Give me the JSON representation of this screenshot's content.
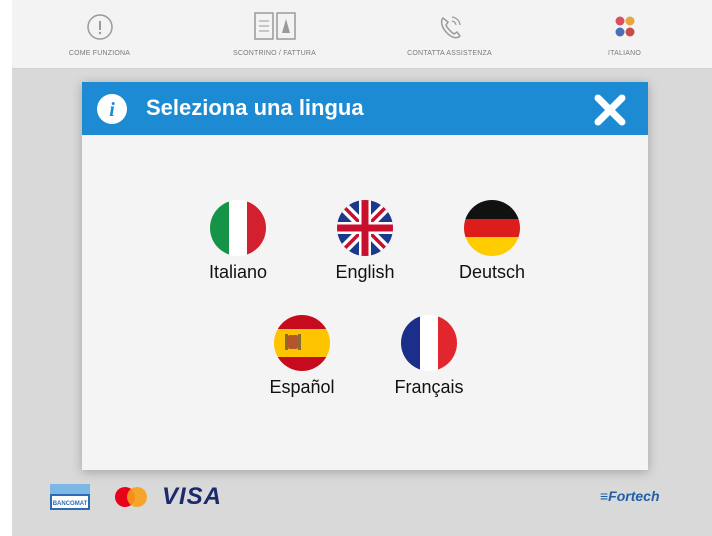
{
  "topbar": {
    "items": [
      {
        "label": "COME FUNZIONA",
        "icon": "info-circle-icon"
      },
      {
        "label": "SCONTRINO / FATTURA",
        "icon": "receipt-icon"
      },
      {
        "label": "CONTATTA ASSISTENZA",
        "icon": "phone-icon"
      },
      {
        "label": "ITALIANO",
        "icon": "flags-icon"
      }
    ]
  },
  "modal": {
    "title": "Seleziona una lingua",
    "languages": [
      {
        "label": "Italiano",
        "flag": "italy-flag-icon"
      },
      {
        "label": "English",
        "flag": "uk-flag-icon"
      },
      {
        "label": "Deutsch",
        "flag": "germany-flag-icon"
      },
      {
        "label": "Español",
        "flag": "spain-flag-icon"
      },
      {
        "label": "Français",
        "flag": "france-flag-icon"
      }
    ]
  },
  "footer": {
    "payment_logos": [
      "pagobancomat-logo",
      "mastercard-logo",
      "visa-logo"
    ],
    "visa_text": "VISA",
    "pagobancomat_text": "BANCOMAT",
    "brand_text": "≡Fortech"
  },
  "colors": {
    "header_blue": "#1d8ad4",
    "modal_background": "#f4f4f4",
    "screen_background": "#e7e7e7"
  }
}
